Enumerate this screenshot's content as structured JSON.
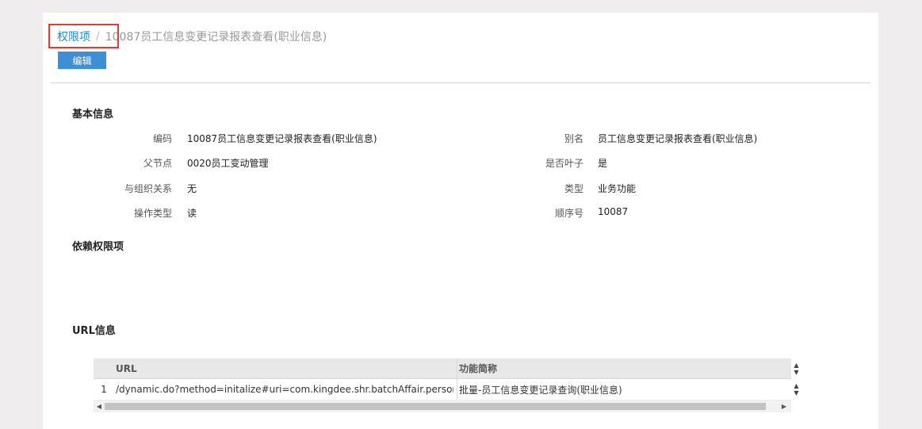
{
  "breadcrumb": {
    "root": "权限项",
    "separator": "/",
    "current": "10087员工信息变更记录报表查看(职业信息)"
  },
  "toolbar": {
    "edit_label": "编辑"
  },
  "basic_info": {
    "title": "基本信息",
    "fields": {
      "code": {
        "label": "编码",
        "value": "10087员工信息变更记录报表查看(职业信息)"
      },
      "alias": {
        "label": "别名",
        "value": "员工信息变更记录报表查看(职业信息)"
      },
      "parent": {
        "label": "父节点",
        "value": "0020员工变动管理"
      },
      "is_leaf": {
        "label": "是否叶子",
        "value": "是"
      },
      "org_relation": {
        "label": "与组织关系",
        "value": "无"
      },
      "type": {
        "label": "类型",
        "value": "业务功能"
      },
      "op_type": {
        "label": "操作类型",
        "value": "读"
      },
      "order": {
        "label": "顺序号",
        "value": "10087"
      }
    }
  },
  "dependency": {
    "title": "依赖权限项"
  },
  "url_info": {
    "title": "URL信息",
    "columns": {
      "url": "URL",
      "name": "功能简称"
    },
    "rows": [
      {
        "num": "1",
        "url": "/dynamic.do?method=initalize#uri=com.kingdee.shr.batchAffair.person…",
        "name": "批量-员工信息变更记录查询(职业信息)"
      }
    ]
  },
  "colors": {
    "accent": "#3d8fd6",
    "link": "#1a8fd0",
    "highlight": "#e53935"
  }
}
